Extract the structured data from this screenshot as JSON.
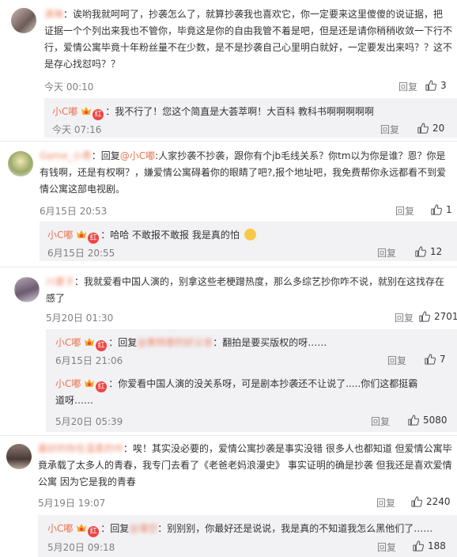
{
  "labels": {
    "reply": "回复",
    "colon": "：",
    "reply_prefix": "回复"
  },
  "c1": {
    "user": "清琳",
    "text": "诶哟我就呵呵了，抄袭怎么了，就算抄袭我也喜欢它，你一定要来这里傻傻的说证据，把证据一个个列出来我也不管你，毕竟这是你的自由我管不着是吧，但是还是请你稍稍收敛一下行不行，爱情公寓毕竟十年粉丝量不在少数，是不是抄袭自己心里明白就好，一定要发出来吗？？这不是存心找怼吗？？",
    "time": "今天 00:10",
    "likes": "3",
    "reply": {
      "user": "小C嘟",
      "text": "我不行了！您这个简直是大荟萃啊！大百科 教科书啊啊啊啊啊",
      "time": "今天 07:16",
      "likes": "20"
    }
  },
  "c2": {
    "user": "Game_小青",
    "reply_to": "@小C嘟",
    "text": ":人家抄袭不抄袭，跟你有个jb毛线关系？你tm以为你是谁？恩？你是有钱啊，还是有权啊？，嫌爱情公寓碍着你的眼睛了吧?,报个地址吧，我免费帮你永远都看不到爱情公寓这部电视剧。",
    "time": "6月15日 20:53",
    "likes": "1",
    "reply": {
      "user": "小C嘟",
      "text": "哈哈 不敢报不敢报 我是真的怕",
      "time": "6月15日 20:55",
      "likes": "12"
    }
  },
  "c3": {
    "user": "川夏子",
    "text": "我就爱看中国人演的，别拿这些老梗蹭热度，那么多综艺抄你咋不说，就别在这找存在感了",
    "time": "5月20日 01:30",
    "likes": "2701",
    "reply1": {
      "user": "小C嘟",
      "reply_to": "@黄特摩的好父亲",
      "text": "翻拍是要买版权的呀……",
      "time": "6月15日 21:06",
      "likes": "7"
    },
    "reply2": {
      "user": "小C嘟",
      "text": "你爱看中国人演的没关系呀，可是剧本抄袭还不让说了.....你们这都挺霸道呀……",
      "time": "5月20日 05:39",
      "likes": "5080"
    }
  },
  "c4": {
    "user": "最好的你在温柔的中",
    "text": "唉！其实没必要的，爱情公寓抄袭是事实没错 很多人也都知道 但爱情公寓毕竟承载了太多人的青春，我专门去看了《老爸老妈浪漫史》 事实证明的确是抄袭 但我还是喜欢爱情公寓 因为它是我的青春",
    "time": "5月19日 19:07",
    "likes": "2240",
    "reply": {
      "user": "小C嘟",
      "reply_to": "@蒲空",
      "text": "别别别，你最好还是说说，我是真的不知道我怎么黑他们了……",
      "time": "5月20日 09:18",
      "likes": "188"
    }
  },
  "colors": {
    "username": "#eb7350",
    "subbox": "#f2f2f5",
    "meta": "#808080"
  }
}
